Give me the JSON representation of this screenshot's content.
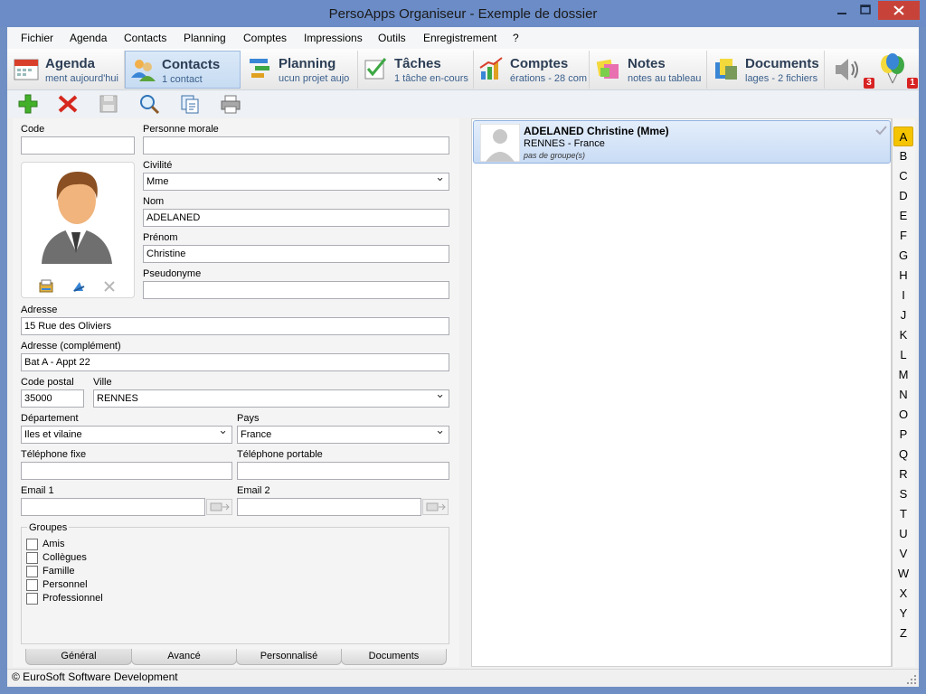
{
  "window": {
    "title": "PersoApps Organiseur - Exemple de dossier"
  },
  "menu": [
    "Fichier",
    "Agenda",
    "Contacts",
    "Planning",
    "Comptes",
    "Impressions",
    "Outils",
    "Enregistrement",
    "?"
  ],
  "modules": [
    {
      "label": "Agenda",
      "sub": "ment aujourd'hui"
    },
    {
      "label": "Contacts",
      "sub": "1 contact"
    },
    {
      "label": "Planning",
      "sub": "ucun projet aujo"
    },
    {
      "label": "Tâches",
      "sub": "1 tâche en-cours"
    },
    {
      "label": "Comptes",
      "sub": "érations - 28 com"
    },
    {
      "label": "Notes",
      "sub": "notes au tableau"
    },
    {
      "label": "Documents",
      "sub": "lages - 2 fichiers"
    }
  ],
  "badges": {
    "sound": "3",
    "balloons": "1"
  },
  "form": {
    "code_label": "Code",
    "code_value": "",
    "personne_morale_label": "Personne morale",
    "personne_morale_value": "",
    "civilite_label": "Civilité",
    "civilite_value": "Mme",
    "nom_label": "Nom",
    "nom_value": "ADELANED",
    "prenom_label": "Prénom",
    "prenom_value": "Christine",
    "pseudonyme_label": "Pseudonyme",
    "pseudonyme_value": "",
    "adresse_label": "Adresse",
    "adresse_value": "15 Rue des Oliviers",
    "adresse2_label": "Adresse (complément)",
    "adresse2_value": "Bat A - Appt 22",
    "cp_label": "Code postal",
    "cp_value": "35000",
    "ville_label": "Ville",
    "ville_value": "RENNES",
    "departement_label": "Département",
    "departement_value": "Iles et vilaine",
    "pays_label": "Pays",
    "pays_value": "France",
    "tel_fixe_label": "Téléphone fixe",
    "tel_fixe_value": "",
    "tel_portable_label": "Téléphone portable",
    "tel_portable_value": "",
    "email1_label": "Email 1",
    "email1_value": "",
    "email2_label": "Email 2",
    "email2_value": "",
    "groupes_label": "Groupes",
    "groupes": [
      "Amis",
      "Collègues",
      "Famille",
      "Personnel",
      "Professionnel"
    ]
  },
  "tabs": [
    "Général",
    "Avancé",
    "Personnalisé",
    "Documents"
  ],
  "contact_card": {
    "name": "ADELANED Christine (Mme)",
    "city": "RENNES - France",
    "groups": "pas de groupe(s)"
  },
  "alphabet": [
    "A",
    "B",
    "C",
    "D",
    "E",
    "F",
    "G",
    "H",
    "I",
    "J",
    "K",
    "L",
    "M",
    "N",
    "O",
    "P",
    "Q",
    "R",
    "S",
    "T",
    "U",
    "V",
    "W",
    "X",
    "Y",
    "Z"
  ],
  "status": {
    "copyright": "© EuroSoft Software Development"
  },
  "colors": {
    "accent": "#f5c400",
    "titlebar": "#6b8cc6",
    "badge": "#d82323"
  }
}
